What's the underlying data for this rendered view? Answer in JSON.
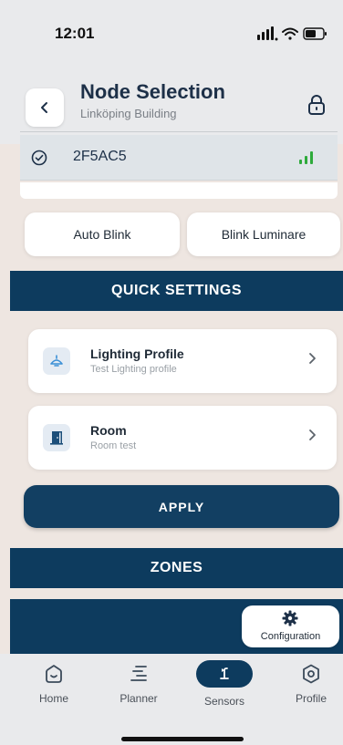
{
  "status_bar": {
    "time": "12:01"
  },
  "header": {
    "title": "Node Selection",
    "subtitle": "Linköping Building"
  },
  "node": {
    "id": "2F5AC5"
  },
  "actions": {
    "auto_blink": "Auto Blink",
    "blink_luminare": "Blink Luminare"
  },
  "sections": {
    "quick_settings": "QUICK SETTINGS",
    "zones": "ZONES"
  },
  "settings": [
    {
      "title": "Lighting Profile",
      "subtitle": "Test Lighting profile",
      "icon": "lamp-icon"
    },
    {
      "title": "Room",
      "subtitle": "Room test",
      "icon": "door-icon"
    }
  ],
  "apply_label": "APPLY",
  "configuration_label": "Configuration",
  "tabs": [
    {
      "label": "Home",
      "icon": "home-icon"
    },
    {
      "label": "Planner",
      "icon": "planner-icon"
    },
    {
      "label": "Sensors",
      "icon": "sensor-icon",
      "active": true
    },
    {
      "label": "Profile",
      "icon": "profile-icon"
    }
  ],
  "colors": {
    "primary": "#0d3b5e",
    "background": "#eee6e1",
    "signal": "#2eaa3b"
  }
}
